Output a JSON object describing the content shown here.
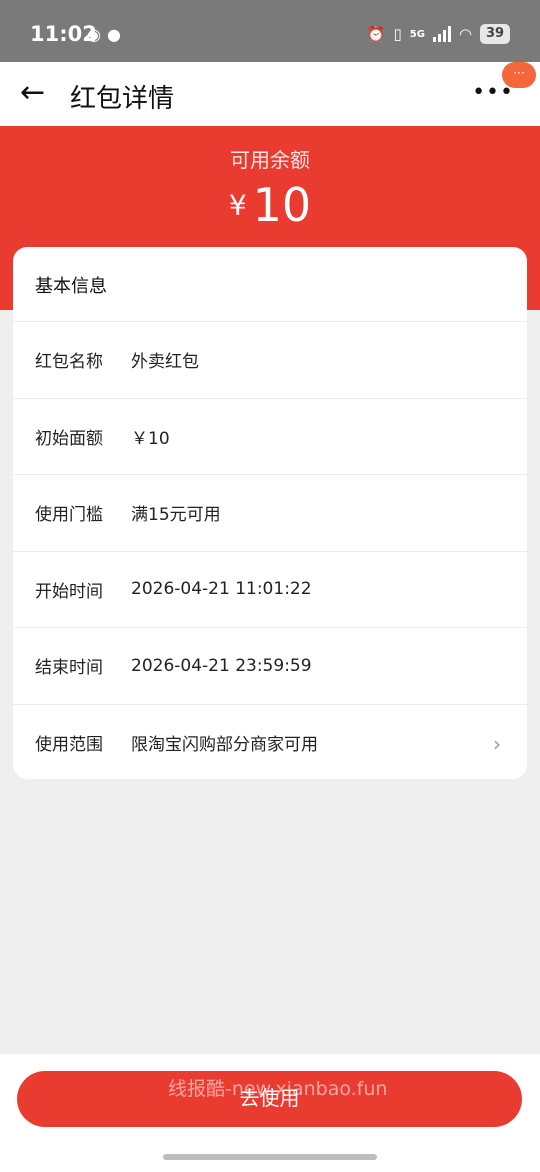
{
  "status_bar": {
    "time": "11:02",
    "battery": "39",
    "network": "5G",
    "icons": [
      "weibo-icon",
      "wechat-icon",
      "alarm-icon",
      "vibrate-icon",
      "signal-icon",
      "wifi-icon"
    ]
  },
  "nav": {
    "title": "红包详情",
    "back_glyph": "←",
    "more_glyph": "•••",
    "badge_glyph": "···"
  },
  "hero": {
    "label": "可用余额",
    "currency": "¥",
    "amount": "10",
    "bg_color": "#e93b2f"
  },
  "card": {
    "title": "基本信息",
    "rows": [
      {
        "label": "红包名称",
        "value": "外卖红包"
      },
      {
        "label": "初始面额",
        "value": "￥10"
      },
      {
        "label": "使用门槛",
        "value": "满15元可用"
      },
      {
        "label": "开始时间",
        "value": "2026-04-21 11:01:22"
      },
      {
        "label": "结束时间",
        "value": "2026-04-21 23:59:59"
      },
      {
        "label": "使用范围",
        "value": "限淘宝闪购部分商家可用",
        "chevron": "›"
      }
    ]
  },
  "bottom": {
    "button_label": "去使用",
    "watermark": "线报酷-new.xianbao.fun"
  },
  "colors": {
    "accent": "#e93b2f",
    "badge": "#f5663a",
    "page_bg": "#efefef"
  }
}
